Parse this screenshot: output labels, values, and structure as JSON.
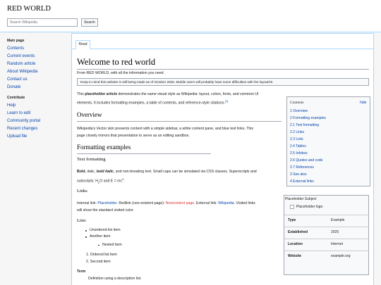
{
  "header": {
    "site_title": "RED WORLD",
    "search_placeholder": "Search Wikipedia",
    "search_button": "Search"
  },
  "sidebar": {
    "main_heading": "Main page",
    "main_items": [
      "Contents",
      "Current events",
      "Random article",
      "About Wikipedia",
      "Contact us",
      "Donate"
    ],
    "contribute_heading": "Contribute",
    "contribute_items": [
      "Help",
      "Learn to edit",
      "Community portal",
      "Recent changes",
      "Upload file"
    ]
  },
  "tabs": {
    "read": "Read"
  },
  "article": {
    "title": "Welcome to red world",
    "intro": "From RED WORLD, with all the information you need.",
    "notice": "Keep in mind this website is still being made as of October 2025. Mobile users will probably have some difficulties with the layout/UI.",
    "p1_bold": "placeholder article",
    "p1_pre": "This ",
    "p1_post": " demonstrates the same visual style as Wikipedia: layout, colors, fonts, and common UI",
    "p1_line2": "elements. It includes formatting examples, a table of contents, and reference-style citations.",
    "p1_cite": "[1]",
    "overview_heading": "Overview",
    "overview_line1": "Wikipedia's Vector skin presents content with a simple sidebar, a white content pane, and blue text links. This",
    "overview_line2": "page closely mirrors that presentation to serve as an editing sandbox.",
    "formatting_heading": "Formatting examples",
    "text_formatting_heading": "Text formatting",
    "tf_bold": "Bold",
    "tf_sep1": ", ",
    "tf_italic": "italic",
    "tf_sep2": ", ",
    "tf_bolditalic": "bold italic",
    "tf_rest": ", and non-breaking text. Small caps can be simulated via CSS classes. Superscripts and",
    "tf_line2_pre": "subscripts: H",
    "tf_sub": "2",
    "tf_line2_mid": "O and E = mc",
    "tf_sup": "2",
    "tf_line2_end": ".",
    "links_heading": "Links",
    "links_pre": "Internal link: ",
    "links_internal": "Placeholder",
    "links_mid1": ". Redlink (non-existent page): ",
    "links_red": "Nonexistent page",
    "links_mid2": ". External link: ",
    "links_external": "Wikipedia",
    "links_end": ". Visited links",
    "links_line2": "will show the standard visited color.",
    "lists_heading": "Lists",
    "unordered": [
      "Unordered list item",
      "Another item"
    ],
    "nested": "Nested item",
    "ordered": [
      "1. Ordered list item",
      "2. Second item"
    ],
    "term": "Term",
    "definition": "Definition using a description list."
  },
  "toc": {
    "title": "Contents",
    "hide": "hide",
    "items": [
      "1 Overview",
      "2 Formatting examples",
      "2.1 Text formatting",
      "2.2 Links",
      "2.3 Lists",
      "2.4 Tables",
      "2.5 Infobox",
      "2.6 Quotes and code",
      "2.7 References",
      "3 See also",
      "4 External links"
    ]
  },
  "infobox": {
    "caption": "Placeholder Subject",
    "logo_alt": "Placeholder logo",
    "rows": [
      {
        "label": "Type",
        "value": "Example"
      },
      {
        "label": "Established",
        "value": "2025"
      },
      {
        "label": "Location",
        "value": "Internet"
      },
      {
        "label": "Website",
        "value": "example.org"
      }
    ]
  },
  "colors": {
    "link": "#0645ad",
    "redlink": "#d33",
    "visited": "#0b0080",
    "border": "#a7d7f9"
  }
}
